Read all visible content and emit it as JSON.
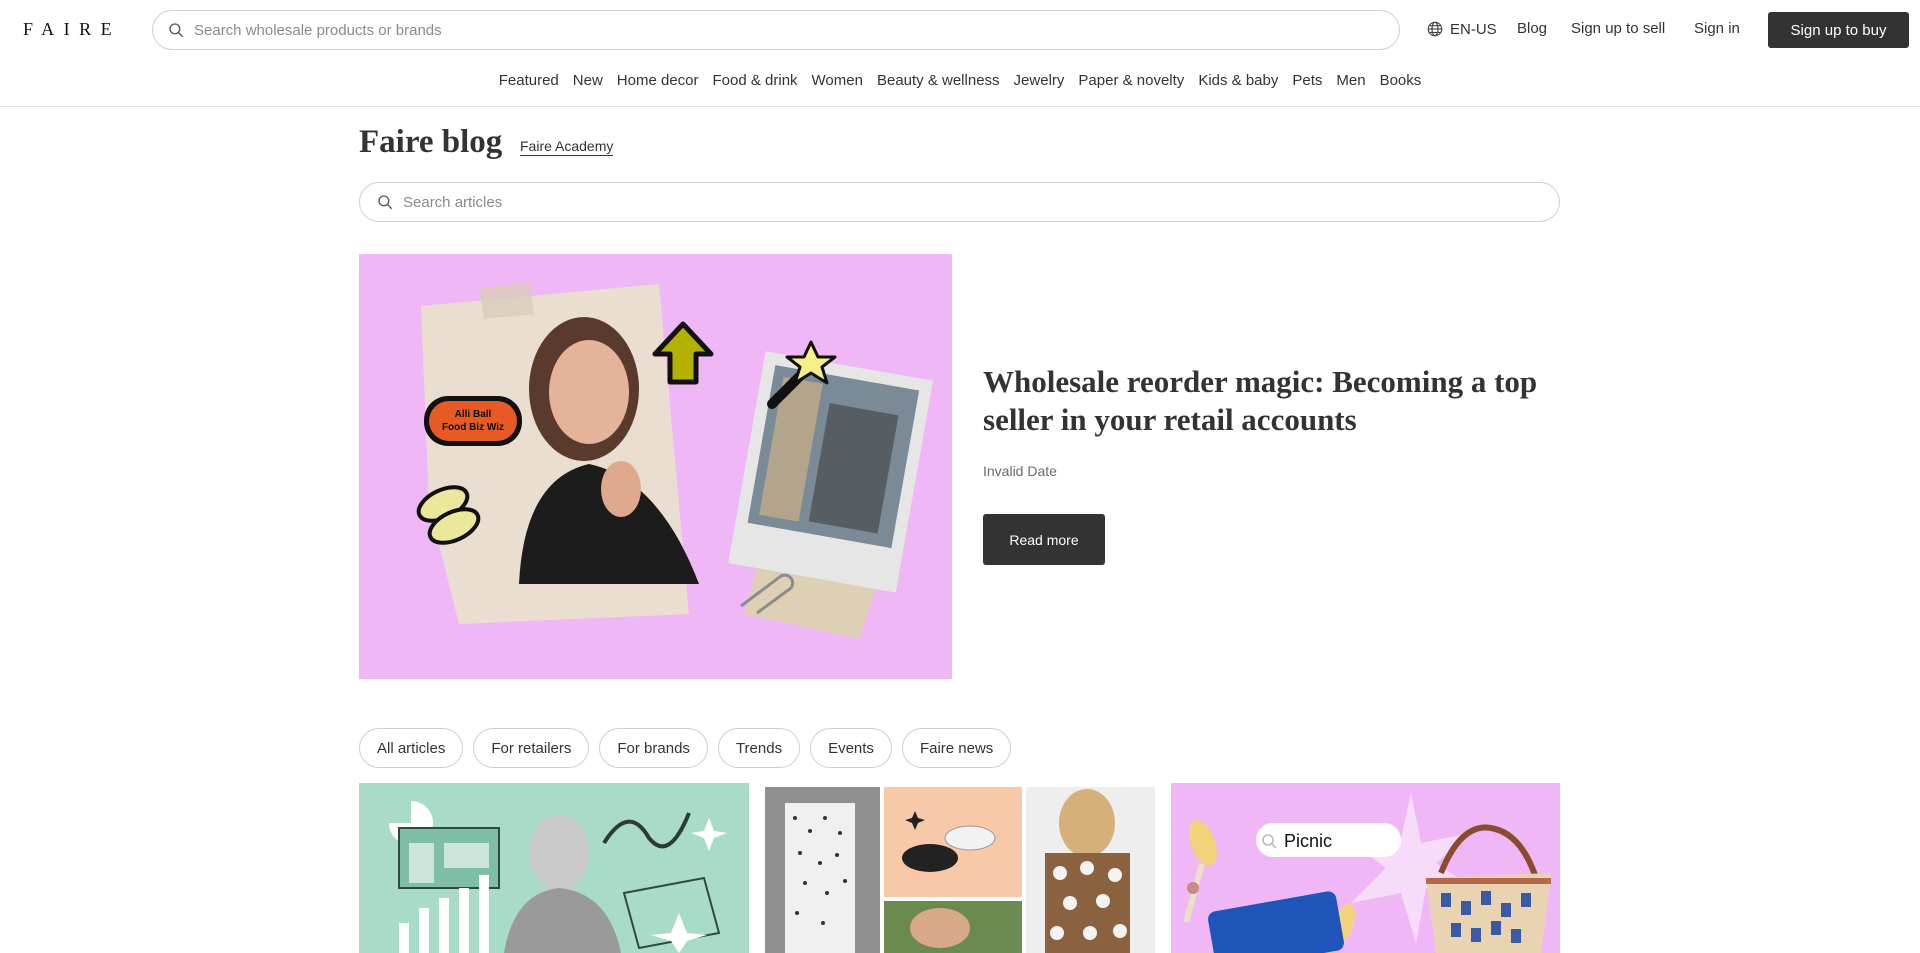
{
  "header": {
    "logo": "FAIRE",
    "search_placeholder": "Search wholesale products or brands",
    "locale": "EN-US",
    "blog": "Blog",
    "sign_up_to_sell": "Sign up to sell",
    "sign_in": "Sign in",
    "sign_up_to_buy": "Sign up to buy"
  },
  "categories": [
    "Featured",
    "New",
    "Home decor",
    "Food & drink",
    "Women",
    "Beauty & wellness",
    "Jewelry",
    "Paper & novelty",
    "Kids & baby",
    "Pets",
    "Men",
    "Books"
  ],
  "blog": {
    "title": "Faire blog",
    "academy_link": "Faire Academy",
    "search_placeholder": "Search articles"
  },
  "hero": {
    "badge_line1": "Alli Ball",
    "badge_line2": "Food Biz Wiz",
    "title": "Wholesale reorder magic: Becoming a top seller in your retail accounts",
    "date": "Invalid Date",
    "cta": "Read more"
  },
  "filters": [
    "All articles",
    "For retailers",
    "For brands",
    "Trends",
    "Events",
    "Faire news"
  ],
  "cards": {
    "card3_search_label": "Picnic"
  },
  "colors": {
    "dark": "#333333",
    "hero_pink": "#f0b7f7",
    "card_mint": "#a8dcc6",
    "card_pink": "#f0b7f7"
  }
}
